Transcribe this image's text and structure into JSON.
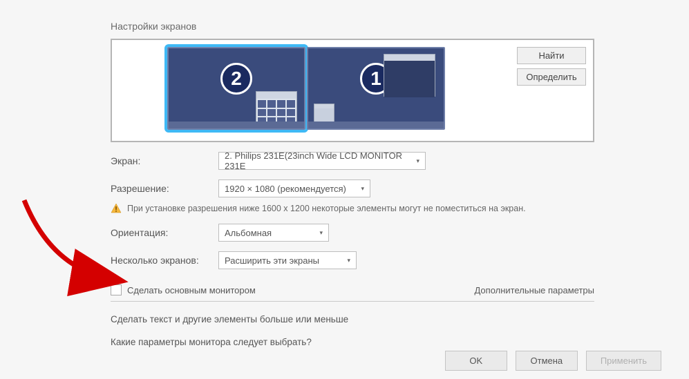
{
  "section_title": "Настройки экранов",
  "monitors": {
    "num2": "2",
    "num1": "1"
  },
  "side": {
    "find": "Найти",
    "identify": "Определить"
  },
  "rows": {
    "screen_label": "Экран:",
    "screen_value": "2. Philips 231E(23inch Wide LCD MONITOR 231E",
    "resolution_label": "Разрешение:",
    "resolution_value": "1920 × 1080 (рекомендуется)",
    "orientation_label": "Ориентация:",
    "orientation_value": "Альбомная",
    "multi_label": "Несколько экранов:",
    "multi_value": "Расширить эти экраны"
  },
  "warning": "При установке разрешения ниже 1600 x 1200 некоторые элементы могут не поместиться на экран.",
  "primary_checkbox": "Сделать основным монитором",
  "advanced_link": "Дополнительные параметры",
  "textlink1": "Сделать текст и другие элементы больше или меньше",
  "textlink2": "Какие параметры монитора следует выбрать?",
  "footer": {
    "ok": "OK",
    "cancel": "Отмена",
    "apply": "Применить"
  }
}
